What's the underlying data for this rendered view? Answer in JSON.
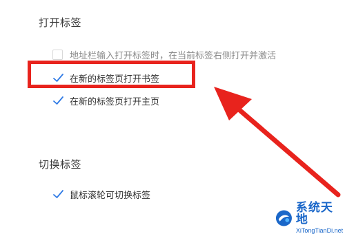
{
  "sections": [
    {
      "title": "打开标签",
      "options": [
        {
          "label": "地址栏输入打开标签时，在当前标签右侧打开并激活",
          "checked": false
        },
        {
          "label": "在新的标签页打开书签",
          "checked": true
        },
        {
          "label": "在新的标签页打开主页",
          "checked": true
        }
      ]
    },
    {
      "title": "切换标签",
      "options": [
        {
          "label": "鼠标滚轮可切换标签",
          "checked": true
        }
      ]
    }
  ],
  "watermark": {
    "cn": "系统天地",
    "en": "XiTongTianDi.net"
  },
  "colors": {
    "accent": "#2f7ae5",
    "annotation": "#e8231d",
    "watermark": "#1a67c9"
  }
}
